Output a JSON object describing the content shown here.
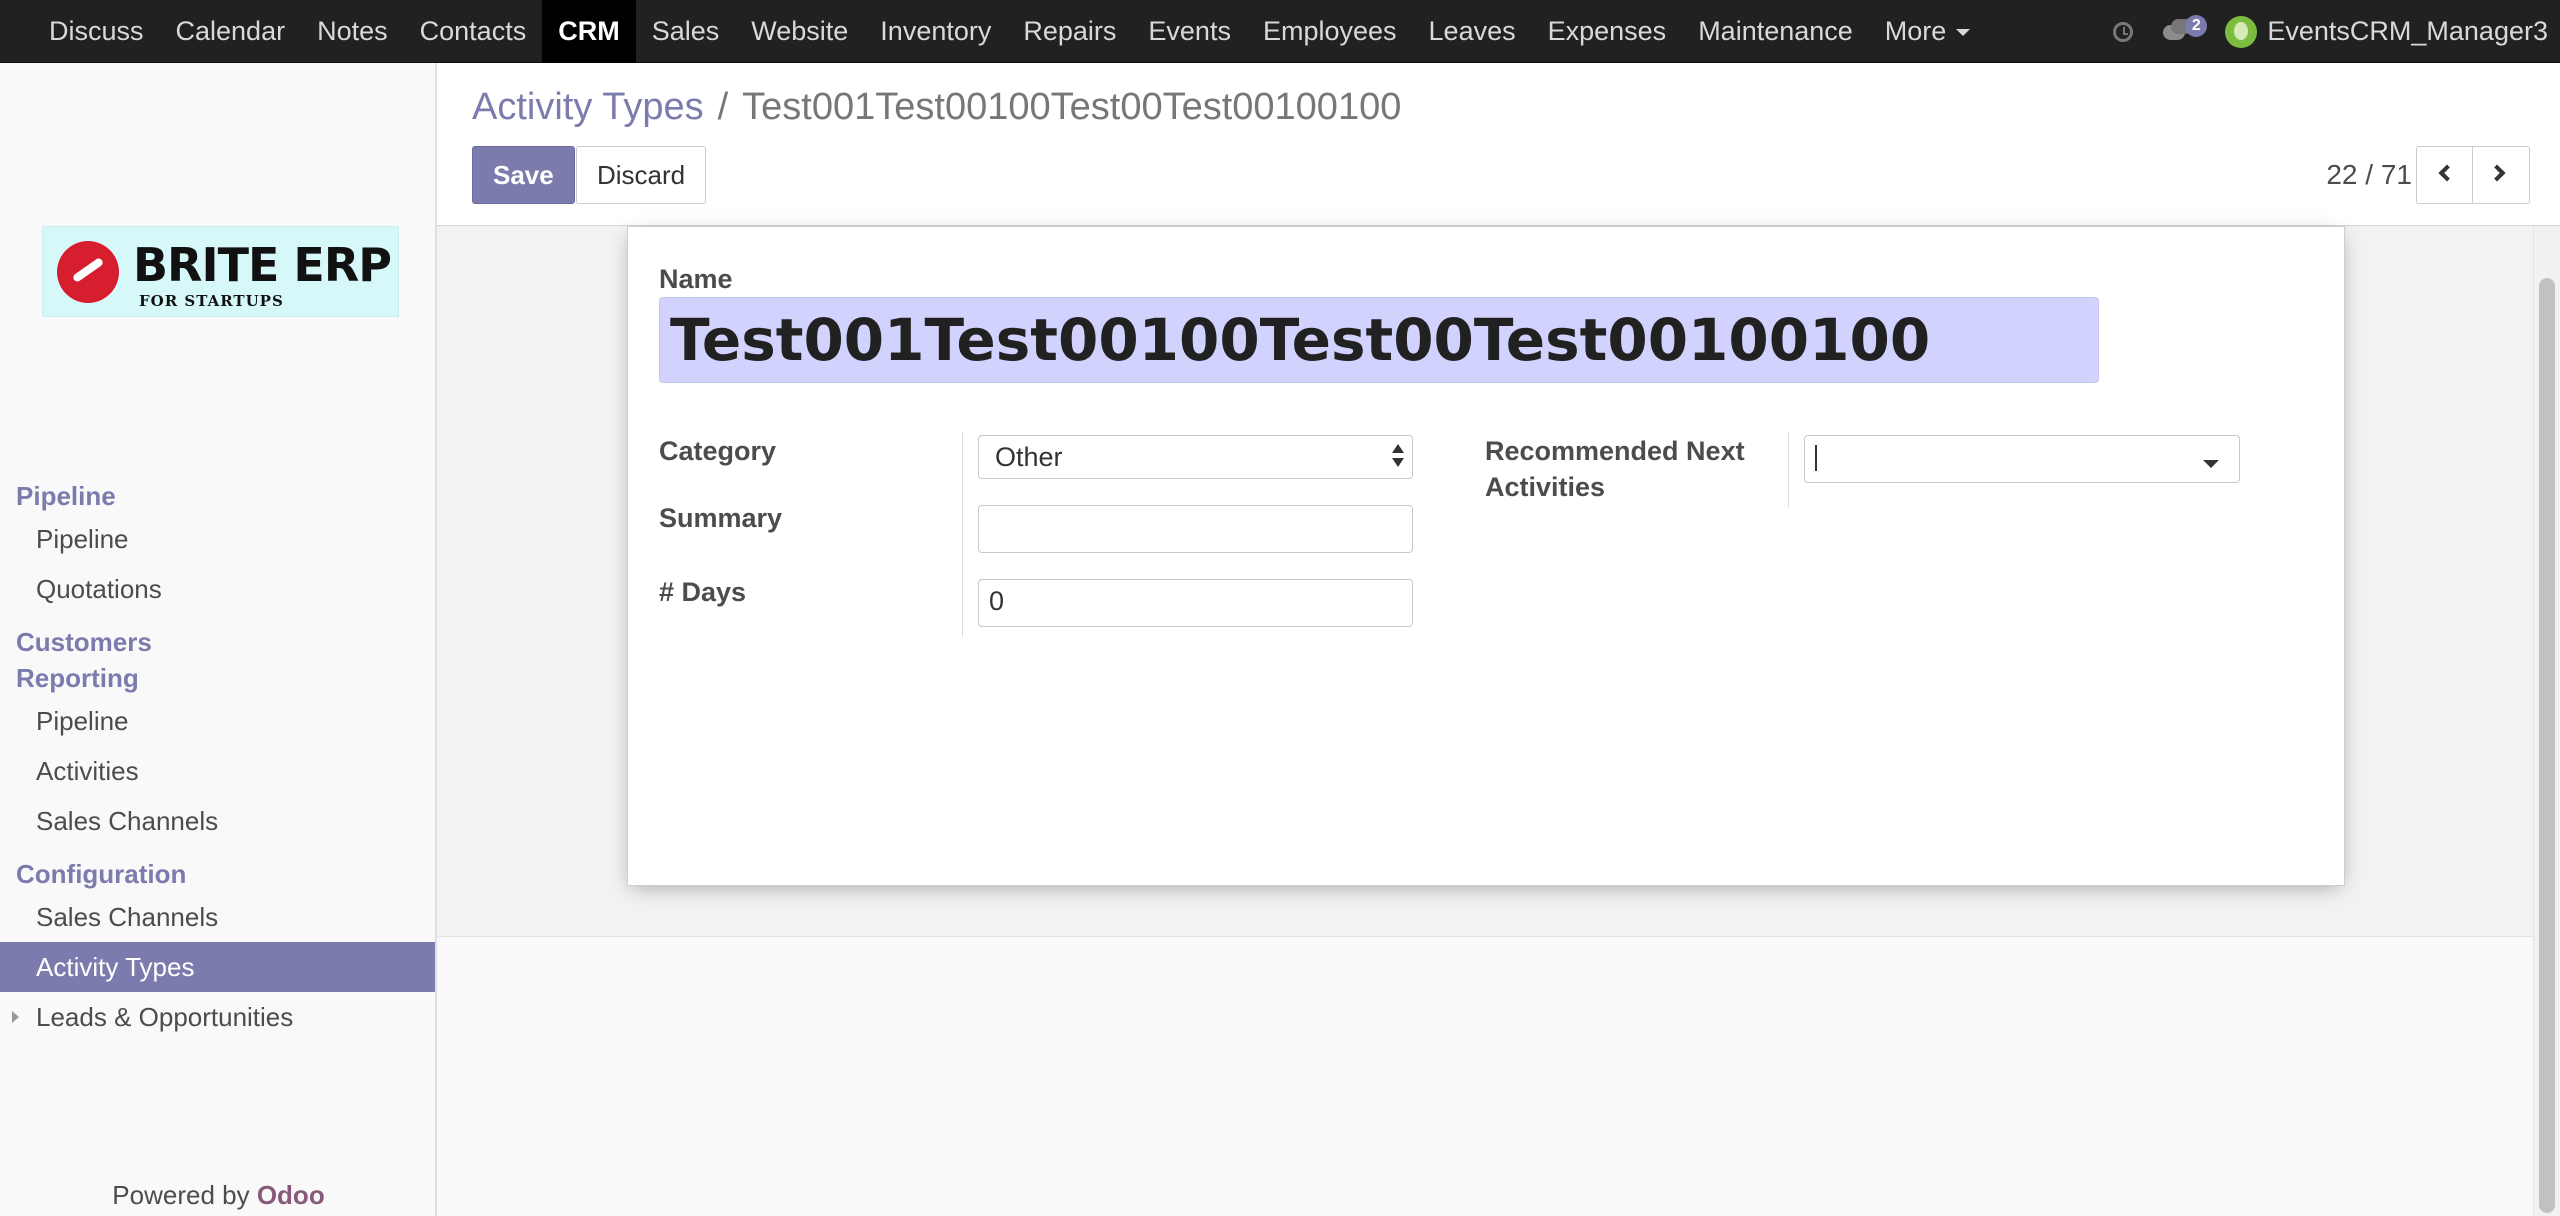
{
  "topbar": {
    "apps": [
      "Discuss",
      "Calendar",
      "Notes",
      "Contacts",
      "CRM",
      "Sales",
      "Website",
      "Inventory",
      "Repairs",
      "Events",
      "Employees",
      "Leaves",
      "Expenses",
      "Maintenance",
      "More"
    ],
    "active_app": "CRM",
    "chat_badge": "2",
    "user_name": "EventsCRM_Manager3"
  },
  "logo": {
    "brand": "BRITE ERP",
    "tagline": "FOR STARTUPS"
  },
  "sidebar": {
    "sections": [
      {
        "title": "Pipeline",
        "items": [
          "Pipeline",
          "Quotations"
        ]
      },
      {
        "title": "Customers Reporting",
        "items": [
          "Pipeline",
          "Activities",
          "Sales Channels"
        ]
      },
      {
        "title": "Configuration",
        "items": [
          "Sales Channels",
          "Activity Types",
          "Leads & Opportunities"
        ]
      }
    ],
    "active_item": "Activity Types",
    "powered_by": "Powered by",
    "powered_brand": "Odoo"
  },
  "breadcrumb": {
    "parent": "Activity Types",
    "separator": "/",
    "current": "Test001Test00100Test00Test00100100"
  },
  "buttons": {
    "save": "Save",
    "discard": "Discard"
  },
  "pager": {
    "value": "22 / 71"
  },
  "form": {
    "name_label": "Name",
    "name_value": "Test001Test00100Test00Test00100100",
    "category_label": "Category",
    "category_value": "Other",
    "summary_label": "Summary",
    "summary_value": "",
    "days_label": "# Days",
    "days_value": "0",
    "recommended_label_line1": "Recommended Next",
    "recommended_label_line2": "Activities",
    "recommended_value": ""
  },
  "colors": {
    "accent": "#7c7bad",
    "navbar": "#212121",
    "name_highlight": "#d2d2ff",
    "odoo_brand": "#875a7b"
  }
}
